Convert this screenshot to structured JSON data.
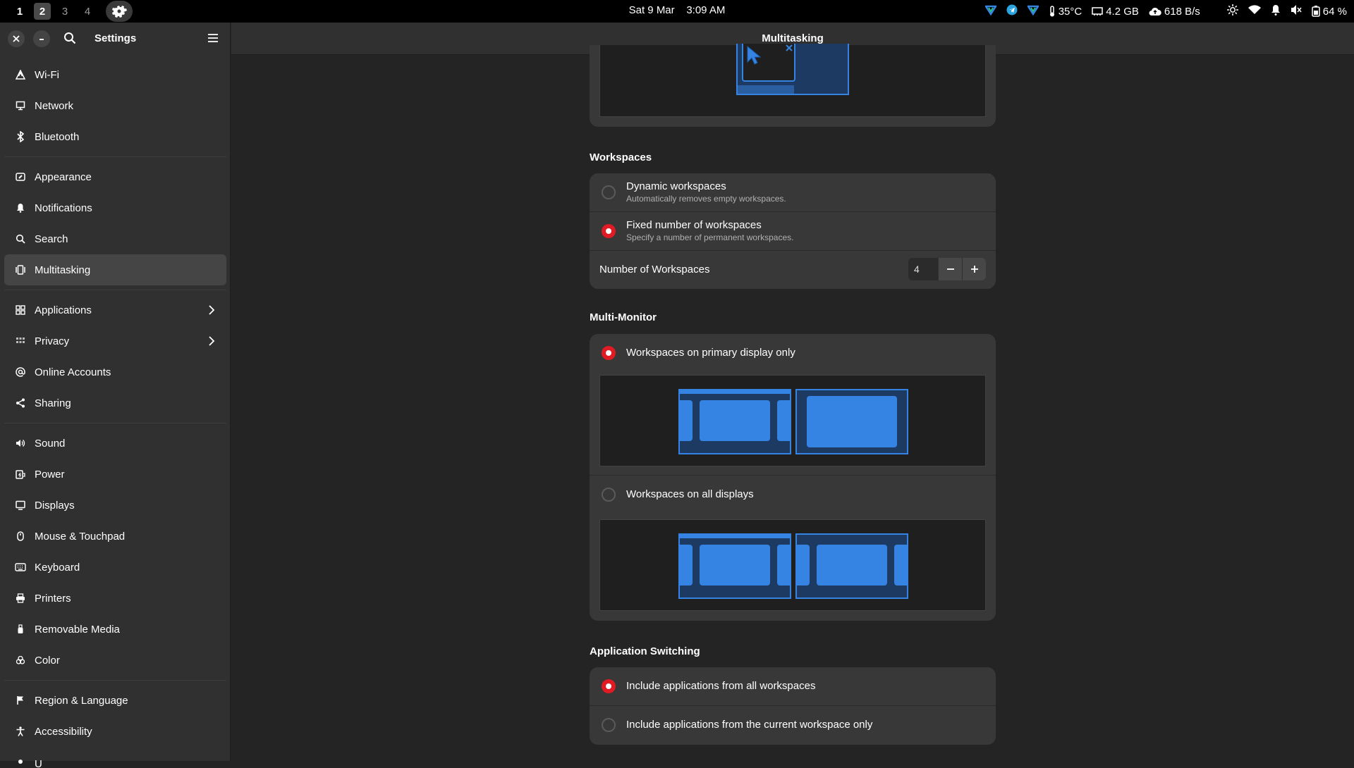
{
  "topbar": {
    "workspaces": [
      "1",
      "2",
      "3",
      "4"
    ],
    "date": "Sat 9 Mar",
    "time": "3:09 AM",
    "temperature": "35°C",
    "memory": "4.2 GB",
    "network_speed": "618 B/s",
    "battery": "64 %"
  },
  "window": {
    "title": "Settings",
    "page_title": "Multitasking"
  },
  "sidebar": {
    "items": [
      {
        "label": "Wi-Fi",
        "icon": "wifi-icon"
      },
      {
        "label": "Network",
        "icon": "network-icon"
      },
      {
        "label": "Bluetooth",
        "icon": "bluetooth-icon"
      },
      {
        "label": "Appearance",
        "icon": "appearance-icon"
      },
      {
        "label": "Notifications",
        "icon": "bell-icon"
      },
      {
        "label": "Search",
        "icon": "search-icon"
      },
      {
        "label": "Multitasking",
        "icon": "multitasking-icon",
        "selected": true
      },
      {
        "label": "Applications",
        "icon": "apps-grid-icon",
        "chevron": true
      },
      {
        "label": "Privacy",
        "icon": "privacy-icon",
        "chevron": true
      },
      {
        "label": "Online Accounts",
        "icon": "at-icon"
      },
      {
        "label": "Sharing",
        "icon": "share-icon"
      },
      {
        "label": "Sound",
        "icon": "speaker-icon"
      },
      {
        "label": "Power",
        "icon": "power-icon"
      },
      {
        "label": "Displays",
        "icon": "display-icon"
      },
      {
        "label": "Mouse & Touchpad",
        "icon": "mouse-icon"
      },
      {
        "label": "Keyboard",
        "icon": "keyboard-icon"
      },
      {
        "label": "Printers",
        "icon": "printer-icon"
      },
      {
        "label": "Removable Media",
        "icon": "usb-icon"
      },
      {
        "label": "Color",
        "icon": "color-icon"
      },
      {
        "label": "Region & Language",
        "icon": "flag-icon"
      },
      {
        "label": "Accessibility",
        "icon": "accessibility-icon"
      },
      {
        "label": "U",
        "icon": "users-icon"
      }
    ]
  },
  "workspaces_section": {
    "title": "Workspaces",
    "dynamic_title": "Dynamic workspaces",
    "dynamic_sub": "Automatically removes empty workspaces.",
    "fixed_title": "Fixed number of workspaces",
    "fixed_sub": "Specify a number of permanent workspaces.",
    "number_label": "Number of Workspaces",
    "number_value": "4",
    "selected": "fixed"
  },
  "multimonitor_section": {
    "title": "Multi-Monitor",
    "primary_label": "Workspaces on primary display only",
    "all_label": "Workspaces on all displays",
    "selected": "primary"
  },
  "appswitch_section": {
    "title": "Application Switching",
    "all_label": "Include applications from all workspaces",
    "current_label": "Include applications from the current workspace only",
    "selected": "all"
  },
  "colors": {
    "accent": "#3584e4",
    "radio_on": "#e01b24",
    "bg": "#242424",
    "card": "#383838"
  }
}
